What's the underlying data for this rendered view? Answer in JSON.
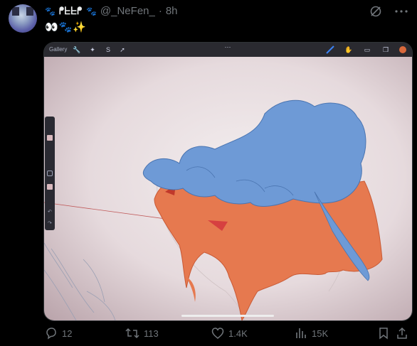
{
  "post": {
    "display_name": "ᖰᖶᖶᖰ",
    "handle": "@_NeFen_",
    "separator": "·",
    "time": "8h",
    "text": "👀🐾✨"
  },
  "media": {
    "app_bar": {
      "gallery_label": "Gallery"
    }
  },
  "actions": {
    "replies": "12",
    "reposts": "113",
    "likes": "1.4K",
    "views": "15K"
  },
  "colors": {
    "paw": "#d2691e",
    "muted": "#71767b",
    "fish_orange": "#e6794f",
    "hand_blue": "#6e9ad6"
  }
}
